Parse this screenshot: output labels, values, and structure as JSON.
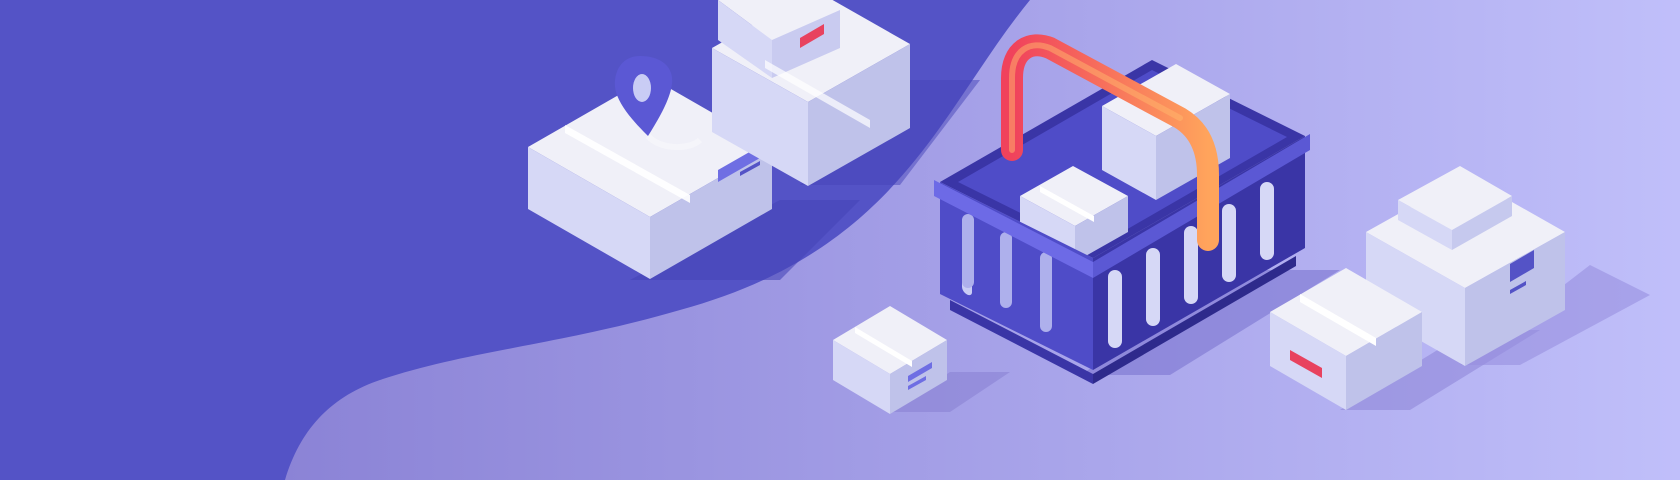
{
  "scene": {
    "description_free": true,
    "colors": {
      "background_left": "#5453c6",
      "background_right_start": "#8b83d6",
      "background_right_end": "#c0bffa",
      "box_top": "#f0f0f8",
      "box_left": "#d6d8f6",
      "box_right": "#bfc2ea",
      "tape": "#ffffff",
      "label_blue": "#6f6ee3",
      "label_red": "#e8425f",
      "basket_dark": "#3a35a6",
      "basket_mid": "#4f4cc8",
      "basket_light": "#6d6ae6",
      "handle_start": "#f0425c",
      "handle_end": "#ffa45c",
      "pin": "#5b58d4"
    },
    "icons": [
      "location-pin-icon",
      "shopping-basket-icon",
      "cardboard-box-icon"
    ]
  }
}
